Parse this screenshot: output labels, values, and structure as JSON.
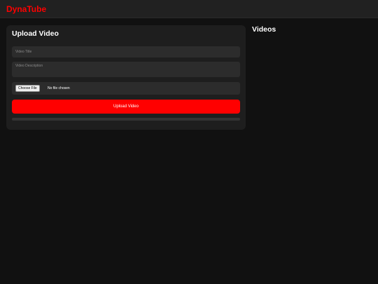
{
  "header": {
    "brand": "DynaTube",
    "brand_color": "#ff0000"
  },
  "upload": {
    "title": "Upload Video",
    "video_title_placeholder": "Video Title",
    "video_title_value": "",
    "description_placeholder": "Video Description",
    "description_value": "",
    "file_button_label": "Choose File",
    "file_status": "No file chosen",
    "submit_label": "Upload Video",
    "progress_percent": 0
  },
  "videos": {
    "title": "Videos"
  }
}
